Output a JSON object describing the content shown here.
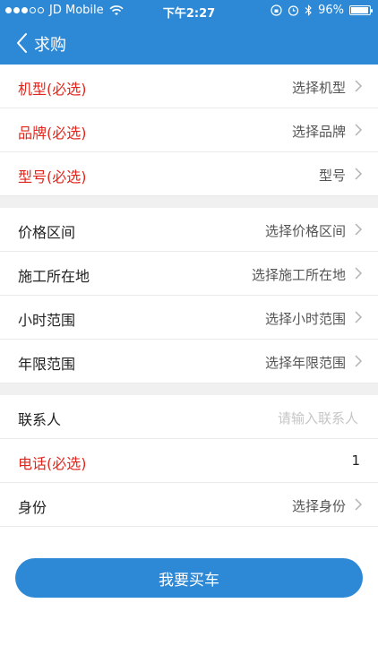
{
  "status_bar": {
    "carrier": "JD Mobile",
    "time": "下午2:27",
    "battery": "96%",
    "battery_level": 0.96
  },
  "nav": {
    "title": "求购"
  },
  "section1": {
    "rows": [
      {
        "label": "机型(必选)",
        "value": "选择机型"
      },
      {
        "label": "品牌(必选)",
        "value": "选择品牌"
      },
      {
        "label": "型号(必选)",
        "value": "型号"
      }
    ]
  },
  "section2": {
    "rows": [
      {
        "label": "价格区间",
        "value": "选择价格区间"
      },
      {
        "label": "施工所在地",
        "value": "选择施工所在地"
      },
      {
        "label": "小时范围",
        "value": "选择小时范围"
      },
      {
        "label": "年限范围",
        "value": "选择年限范围"
      }
    ]
  },
  "section3": {
    "contact": {
      "label": "联系人",
      "placeholder": "请输入联系人"
    },
    "phone": {
      "label": "电话(必选)",
      "value": "1"
    },
    "identity": {
      "label": "身份",
      "value": "选择身份"
    }
  },
  "actions": {
    "buy_label": "我要买车"
  },
  "colors": {
    "primary": "#2d89d6",
    "required": "#e0261c",
    "divider": "#e9e9e9",
    "gap": "#f0f0f0"
  }
}
